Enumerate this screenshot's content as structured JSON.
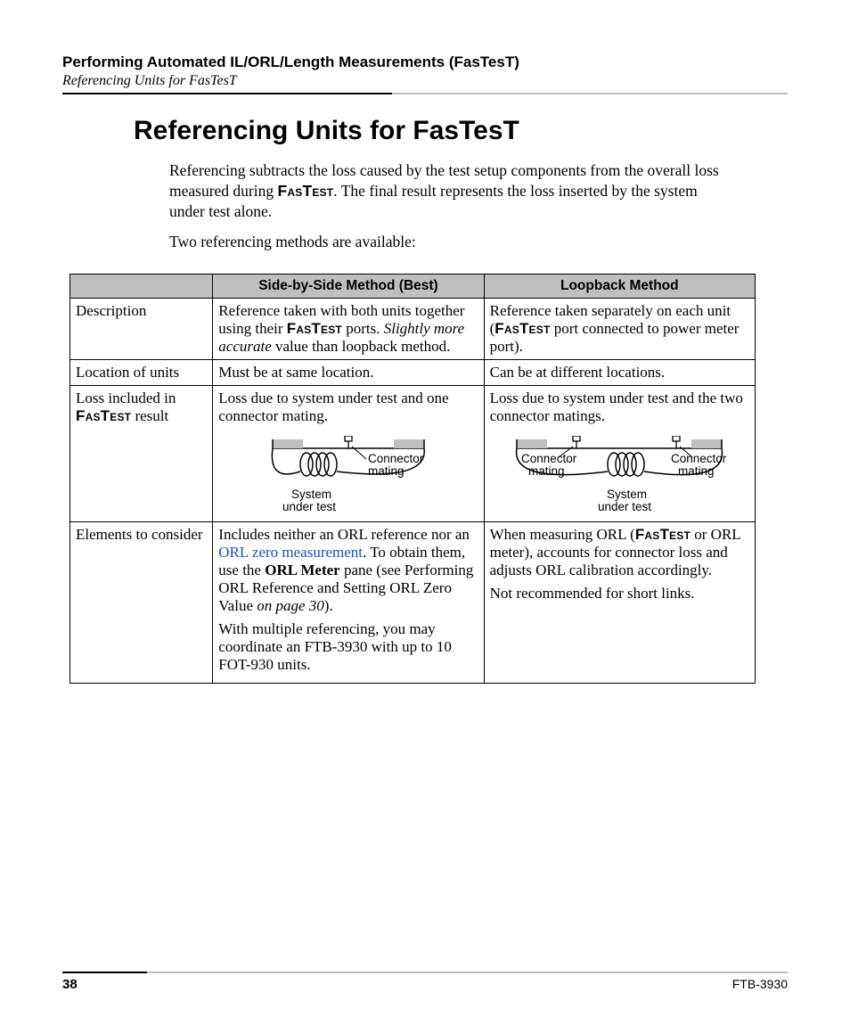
{
  "header": {
    "chapter": "Performing Automated IL/ORL/Length Measurements (FasTesT)",
    "sub": "Referencing Units for FasTesT"
  },
  "title": "Referencing Units for FasTesT",
  "intro": {
    "p1a": "Referencing subtracts the loss caused by the test setup components from the overall loss measured during ",
    "fastest": "FasTest",
    "p1b": ". The final result represents the loss inserted by the system under test alone.",
    "p2": "Two referencing methods are available:"
  },
  "table": {
    "headers": {
      "col_a": "Side-by-Side Method (Best)",
      "col_b": "Loopback Method"
    },
    "rows": {
      "desc": {
        "label": "Description",
        "a1": "Reference taken with both units together using their ",
        "a_fastest": "FasTest",
        "a2": " ports. ",
        "a3": "Slightly more accurate",
        "a4": " value than loopback method.",
        "b1": "Reference taken separately on each unit (",
        "b_fastest": "FasTest",
        "b2": " port connected to power meter port)."
      },
      "loc": {
        "label": "Location of units",
        "a": "Must be at same location.",
        "b": "Can be at different locations."
      },
      "loss": {
        "label_pre": "Loss included in ",
        "label_fastest": "FasTest",
        "label_post": " result",
        "a": "Loss due to system under test and one connector mating.",
        "b": "Loss due to system under test and the two connector matings.",
        "diag_a": {
          "conn": "Connector mating",
          "sys": "System under test"
        },
        "diag_b": {
          "conn1": "Connector mating",
          "conn2": "Connector mating",
          "sys": "System under test"
        }
      },
      "elem": {
        "label": "Elements to consider",
        "a1": "Includes neither an ORL reference nor an ",
        "a_link": "ORL zero measurement",
        "a2": ". To obtain them, use the ",
        "a_bold": "ORL Meter",
        "a3": " pane (see Performing ORL Reference and Setting ORL Zero Value ",
        "a_on": "on page 30",
        "a4": ").",
        "a_p2": "With multiple referencing, you may coordinate an FTB-3930 with up to 10 FOT-930 units.",
        "b1": "When measuring ORL (",
        "b_fastest": "FasTest",
        "b2": " or ORL meter), accounts for connector loss and adjusts ORL calibration accordingly.",
        "b_p2": "Not recommended for short links."
      }
    }
  },
  "footer": {
    "page": "38",
    "doc": "FTB-3930"
  }
}
